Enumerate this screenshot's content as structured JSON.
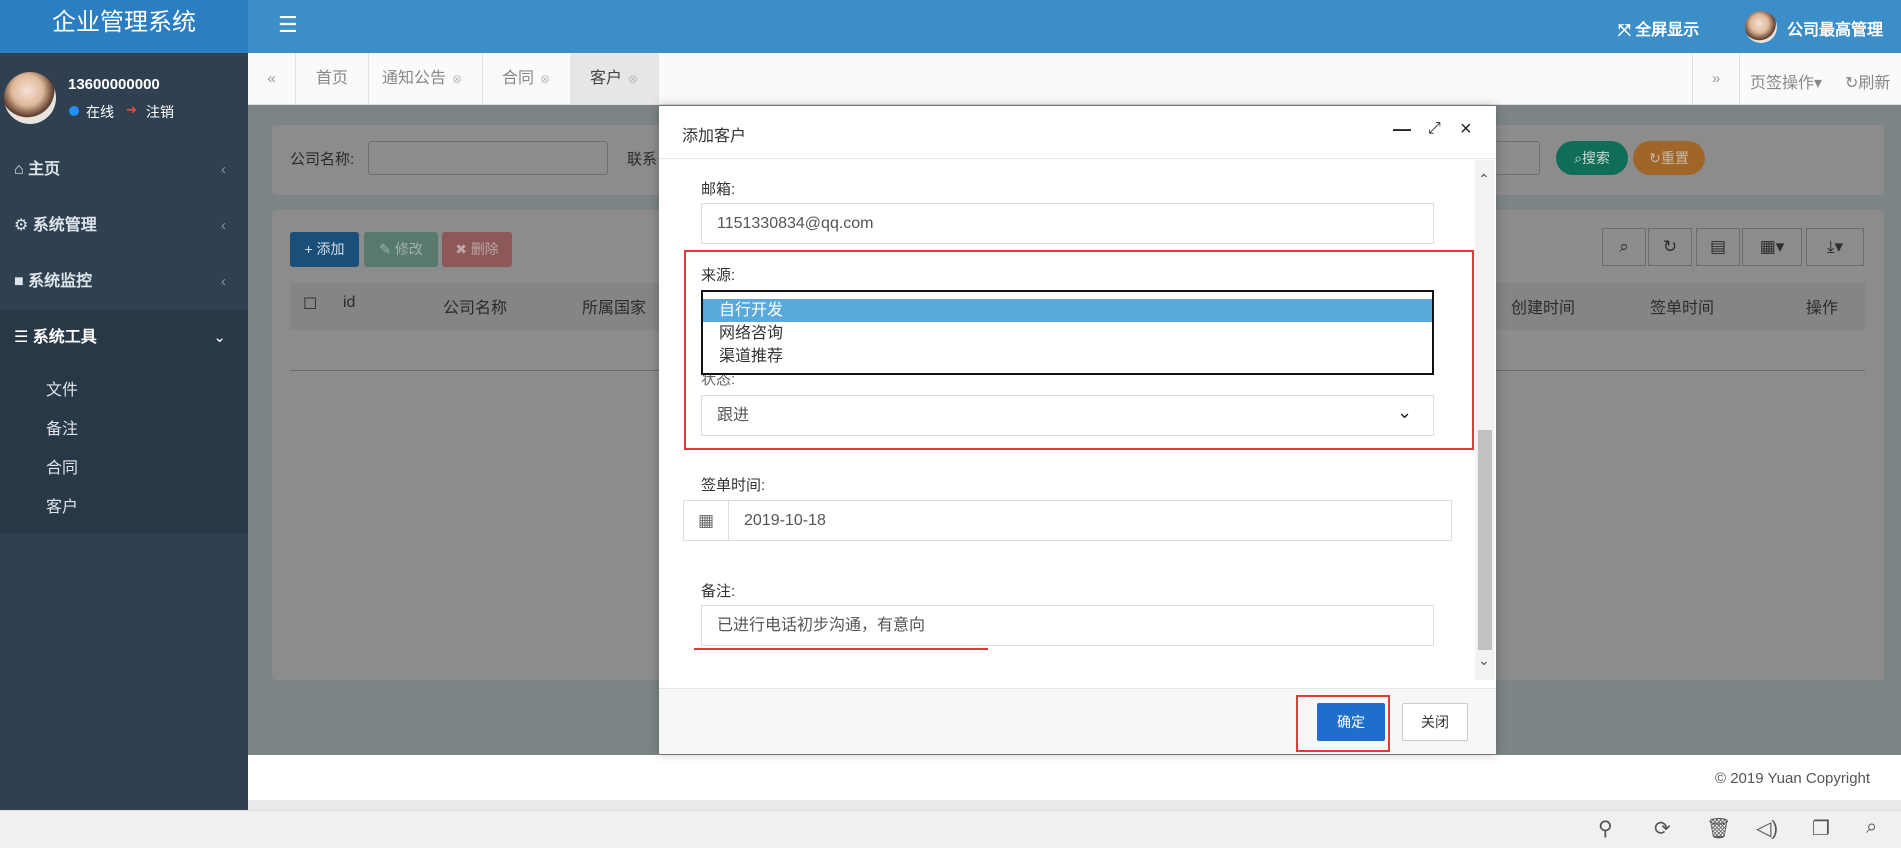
{
  "app": {
    "title": "企业管理系统",
    "fullscreen_label": "全屏显示",
    "admin_name": "公司最高管理"
  },
  "user": {
    "phone": "13600000000",
    "status": "在线",
    "logout": "注销"
  },
  "nav": {
    "items": [
      {
        "label": "主页",
        "icon": "home-icon"
      },
      {
        "label": "系统管理",
        "icon": "gear-icon"
      },
      {
        "label": "系统监控",
        "icon": "video-icon"
      },
      {
        "label": "系统工具",
        "icon": "list-icon"
      }
    ],
    "sub_items": [
      "文件",
      "备注",
      "合同",
      "客户"
    ]
  },
  "tabs": [
    {
      "label": "首页"
    },
    {
      "label": "通知公告"
    },
    {
      "label": "合同"
    },
    {
      "label": "客户"
    }
  ],
  "tab_ops": {
    "ops_label": "页签操作",
    "refresh_label": "刷新"
  },
  "search": {
    "company_label": "公司名称:",
    "contact_label": "联系",
    "search_btn": "搜索",
    "reset_btn": "重置"
  },
  "toolbar": {
    "add": "添加",
    "edit": "修改",
    "delete": "删除"
  },
  "table": {
    "headers_left": [
      "id",
      "公司名称",
      "所属国家"
    ],
    "headers_right": [
      "创建时间",
      "签单时间",
      "操作"
    ]
  },
  "footer": {
    "copyright": "© 2019 Yuan Copyright"
  },
  "modal": {
    "title": "添加客户",
    "email_label": "邮箱:",
    "email_value": "1151330834@qq.com",
    "source_label": "来源:",
    "source_options": [
      "自行开发",
      "网络咨询",
      "渠道推荐"
    ],
    "status_label": "状态:",
    "status_value": "跟进",
    "sign_label": "签单时间:",
    "sign_value": "2019-10-18",
    "note_label": "备注:",
    "note_value": "已进行电话初步沟通，有意向",
    "ok_btn": "确定",
    "close_btn": "关闭"
  },
  "colors": {
    "sidebar": "#2f4050",
    "header": "#3c8ec8",
    "primary_button": "#1e6fcc",
    "highlight": "#e53935"
  }
}
